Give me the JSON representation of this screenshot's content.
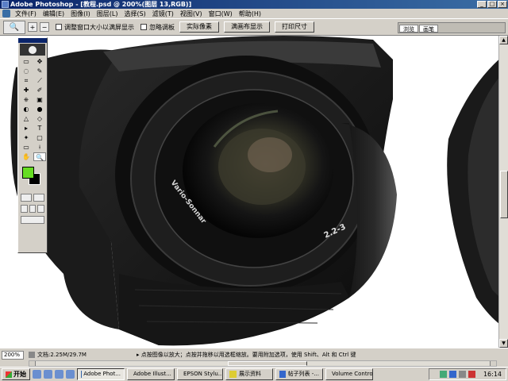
{
  "window": {
    "title": "Adobe Photoshop - [教程.psd @ 200%(图层 13,RGB)]",
    "controls": [
      "_",
      "□",
      "×"
    ]
  },
  "menu": {
    "items": [
      "文件(F)",
      "编辑(E)",
      "图像(I)",
      "图层(L)",
      "选择(S)",
      "滤镜(T)",
      "视图(V)",
      "窗口(W)",
      "帮助(H)"
    ]
  },
  "options": {
    "resize_window_label": "调整窗口大小以满屏显示",
    "ignore_palettes_label": "忽略调板",
    "actual_pixels": "实际像素",
    "fit_on_screen": "满画布显示",
    "print_size": "打印尺寸",
    "well_tabs": [
      "浏览",
      "画笔"
    ]
  },
  "toolbox": {
    "tools": [
      "▭",
      "✥",
      "◌",
      "✎",
      "⌗",
      "⟋",
      "✚",
      "✐",
      "⎈",
      "▣",
      "◐",
      "●",
      "△",
      "◇",
      "▸",
      "T",
      "✦",
      "▢",
      "▭",
      "⟊",
      "✋",
      "🔍"
    ],
    "colors": {
      "foreground": "#66dd22",
      "background": "#000000"
    }
  },
  "lens": {
    "brand_text": "Vario-Sonnar",
    "focal_text": "2.2-3"
  },
  "status": {
    "zoom": "200%",
    "doc_info": "文档:2.25M/29.7M",
    "hint": "▸ 点按图像以放大；点按并拖移以用选框缩放。要用附加选项，使用 Shift、Alt 和 Ctrl 键"
  },
  "taskbar": {
    "start": "开始",
    "tasks": [
      "Adobe Phot...",
      "Adobe Illust...",
      "EPSON Stylu...",
      "展示资料",
      "帖子列表 -...",
      "Volume Control"
    ],
    "clock": "16:14"
  }
}
